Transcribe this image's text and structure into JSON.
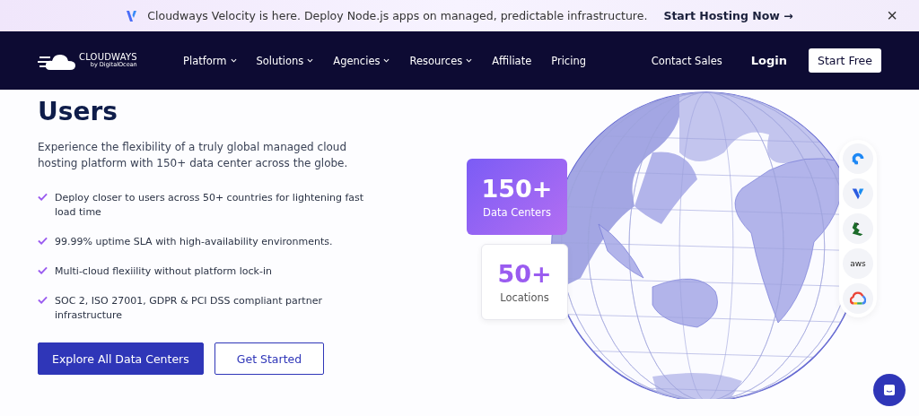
{
  "banner": {
    "text": "Cloudways Velocity is here. Deploy Node.js apps on managed, predictable infrastructure.",
    "link": "Start Hosting Now →",
    "close": "×"
  },
  "nav": {
    "logo": "CLOUDWAYS",
    "logo_sub": "by DigitalOcean",
    "items": [
      {
        "label": "Platform",
        "dropdown": true
      },
      {
        "label": "Solutions",
        "dropdown": true
      },
      {
        "label": "Agencies",
        "dropdown": true
      },
      {
        "label": "Resources",
        "dropdown": true
      },
      {
        "label": "Affiliate",
        "dropdown": false
      },
      {
        "label": "Pricing",
        "dropdown": false
      }
    ],
    "contact": "Contact Sales",
    "login": "Login",
    "cta": "Start Free"
  },
  "hero": {
    "heading": "Users",
    "intro": "Experience the flexibility of a truly global managed cloud hosting platform with 150+ data center across the globe.",
    "features": [
      "Deploy closer to users across 50+ countries for lightening fast load time",
      "99.99% uptime SLA with high-availability environments.",
      "Multi-cloud flexiility without platform lock-in",
      "SOC 2, ISO 27001, GDPR & PCI DSS compliant partner infrastructure"
    ],
    "buttons": [
      {
        "label": "Explore All Data Centers",
        "kind": "primary"
      },
      {
        "label": "Get Started",
        "kind": "outline"
      }
    ]
  },
  "stats": [
    {
      "value": "150+",
      "label": "Data Centers",
      "kind": "filled"
    },
    {
      "value": "50+",
      "label": "Locations",
      "kind": "plain"
    }
  ],
  "providers": [
    {
      "kind": "ring"
    },
    {
      "kind": "v"
    },
    {
      "kind": "leaf"
    },
    {
      "kind": "text",
      "label": "aws"
    },
    {
      "kind": "cloud"
    }
  ]
}
